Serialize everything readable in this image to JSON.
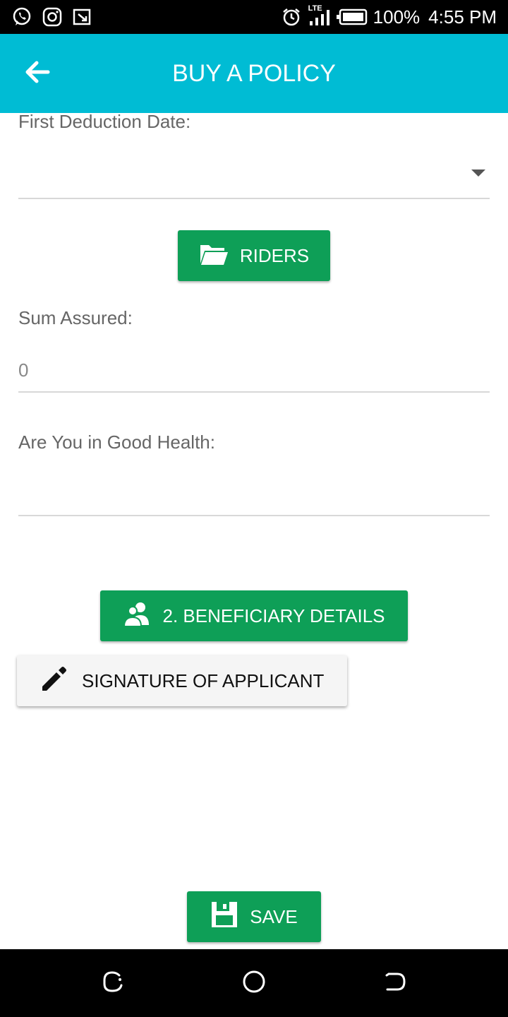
{
  "status_bar": {
    "battery": "100%",
    "time": "4:55 PM",
    "network": "LTE",
    "icons_left": [
      "whatsapp-icon",
      "instagram-icon",
      "cast-icon"
    ],
    "icons_right": [
      "alarm-icon",
      "signal-icon",
      "battery-icon"
    ]
  },
  "app_bar": {
    "title": "BUY A POLICY",
    "back_icon": "arrow-left-icon",
    "color": "#00BCD4"
  },
  "form": {
    "first_deduction_date": {
      "label": "First Deduction Date:",
      "value": ""
    },
    "riders_button": {
      "label": "RIDERS",
      "icon": "folder-open-icon"
    },
    "sum_assured": {
      "label": "Sum Assured:",
      "value": "0"
    },
    "good_health": {
      "label": "Are You in Good Health:",
      "value": ""
    },
    "beneficiary_button": {
      "label": "2. BENEFICIARY DETAILS",
      "icon": "users-icon"
    },
    "signature_button": {
      "label": "SIGNATURE OF APPLICANT",
      "icon": "pencil-icon"
    },
    "save_button": {
      "label": "SAVE",
      "icon": "floppy-disk-icon"
    }
  },
  "colors": {
    "accent_green": "#0E9F57",
    "app_bar": "#00BCD4"
  },
  "nav_bar": {
    "buttons": [
      "recent-apps-icon",
      "home-icon",
      "back-icon"
    ]
  }
}
